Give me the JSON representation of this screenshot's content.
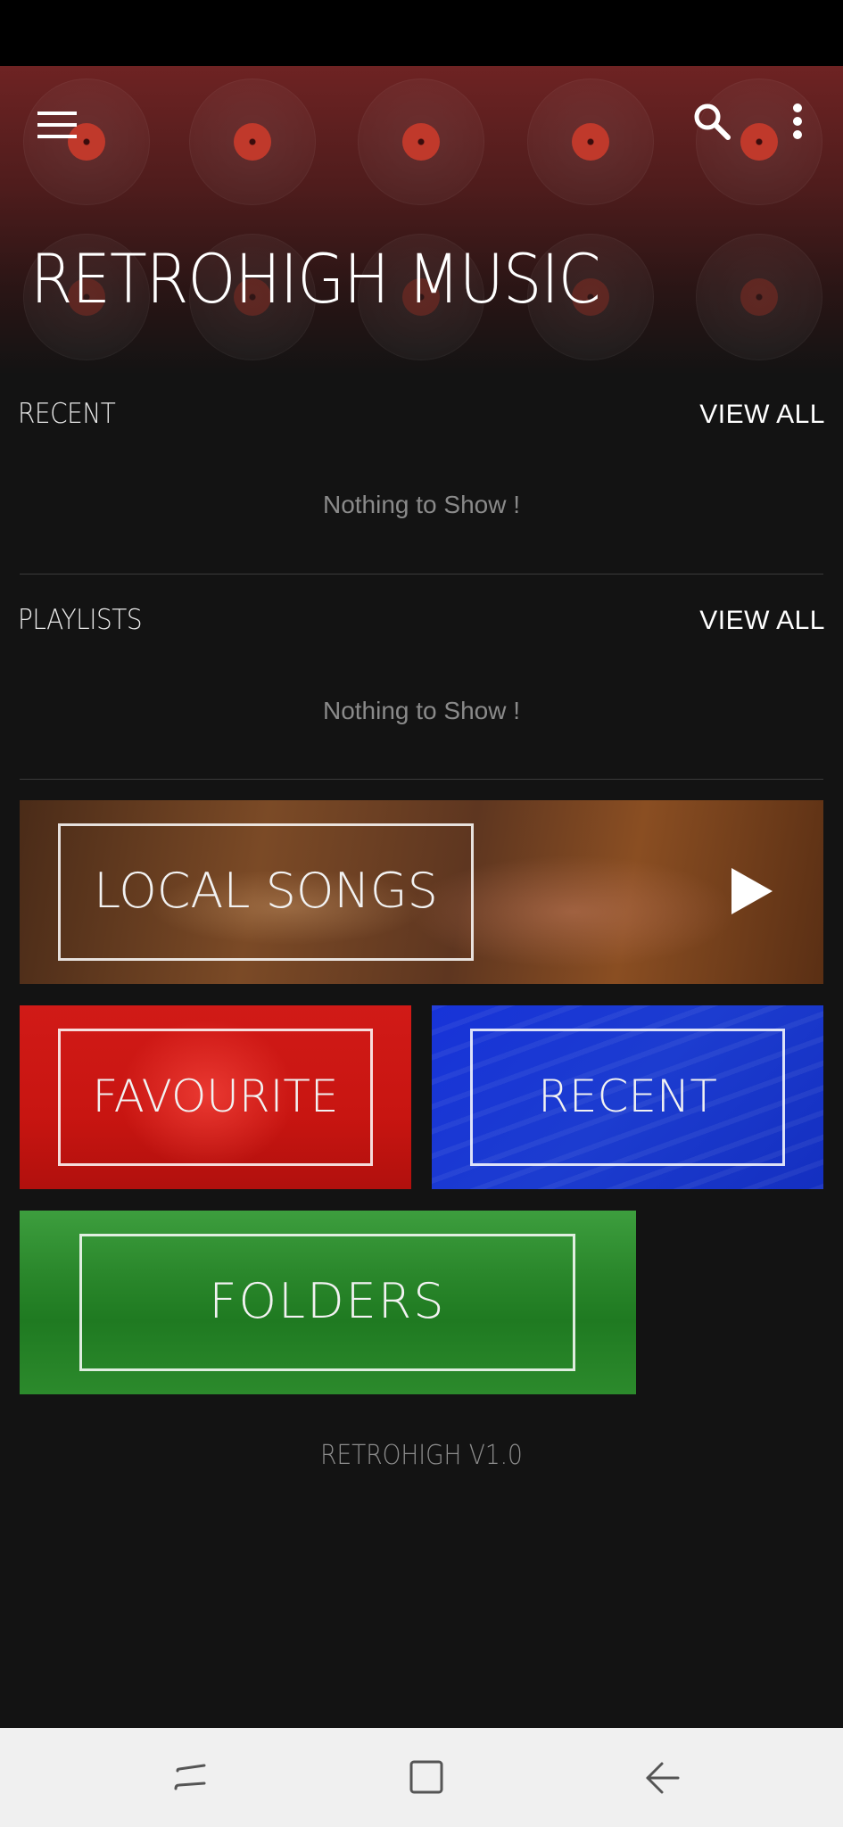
{
  "header": {
    "title": "RETROHIGH MUSIC",
    "menu_icon": "hamburger-menu-icon",
    "search_icon": "search-icon",
    "more_icon": "more-vertical-icon"
  },
  "sections": {
    "recent": {
      "label": "RECENT",
      "view_all": "VIEW ALL",
      "empty_message": "Nothing to Show !"
    },
    "playlists": {
      "label": "PLAYLISTS",
      "view_all": "VIEW ALL",
      "empty_message": "Nothing to Show !"
    }
  },
  "tiles": {
    "local_songs": {
      "label": "LOCAL SONGS",
      "icon": "play-icon"
    },
    "favourite": {
      "label": "FAVOURITE"
    },
    "recent": {
      "label": "RECENT"
    },
    "folders": {
      "label": "FOLDERS"
    }
  },
  "footer": {
    "version": "RETROHIGH V1.0"
  },
  "nav_bar": {
    "recents_icon": "recent-apps-icon",
    "home_icon": "home-icon",
    "back_icon": "back-icon"
  },
  "colors": {
    "background": "#131313",
    "accent_red": "#c0392b",
    "favourite_tile": "#c81511",
    "recent_tile": "#1c3cd0",
    "folders_tile": "#2a872b"
  }
}
